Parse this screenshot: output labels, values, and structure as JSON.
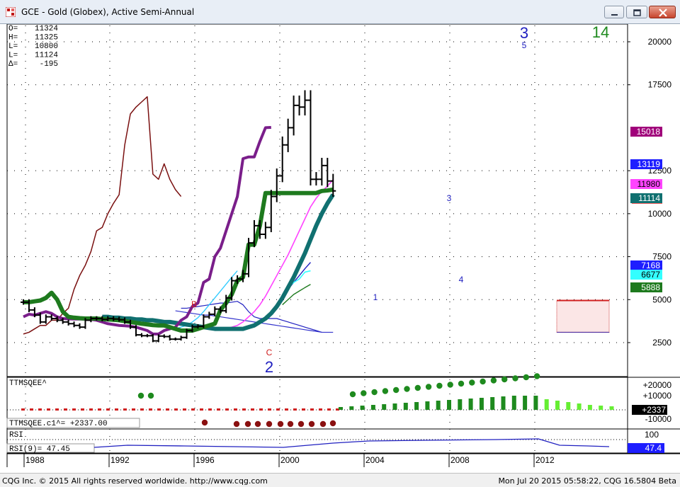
{
  "window": {
    "title": "GCE - Gold (Globex), Active Semi-Annual",
    "buttons": [
      "minimize",
      "restore",
      "close"
    ]
  },
  "ohlc_readout": [
    {
      "label": "O=",
      "value": "11324"
    },
    {
      "label": "H=",
      "value": "11325"
    },
    {
      "label": "L=",
      "value": "10800"
    },
    {
      "label": "L=",
      "value": "11124"
    },
    {
      "label": "Δ=",
      "value": "-195"
    }
  ],
  "wave_labels": {
    "top_count": "3",
    "top_sub": "5",
    "green_count": "14",
    "bottom_count": "2",
    "c_label": "C",
    "b_label": "B",
    "one": "1",
    "three": "3",
    "four": "4"
  },
  "price_axis": {
    "ticks": [
      "20000",
      "17500",
      "12500",
      "10000",
      "7500",
      "5000",
      "2500"
    ],
    "tags": [
      {
        "value": "15018",
        "color": "#a0007a",
        "text_color": "#ffffff"
      },
      {
        "value": "13119",
        "color": "#1e1eff",
        "text_color": "#ffffff"
      },
      {
        "value": "11980",
        "color": "#ff44ff",
        "text_color": "#000000"
      },
      {
        "value": "11114",
        "color": "#107070",
        "text_color": "#ffffff"
      },
      {
        "value": "7168",
        "color": "#1e1eff",
        "text_color": "#ffffff"
      },
      {
        "value": "6677",
        "color": "#33ffff",
        "text_color": "#000000"
      },
      {
        "value": "5888",
        "color": "#1e7a1e",
        "text_color": "#ffffff"
      }
    ]
  },
  "ttm_panel": {
    "label": "TTMSQEE^",
    "readout": "TTMSQEE.c1^=   +2337.00",
    "ticks": [
      "+20000",
      "+10000",
      "-10000"
    ],
    "tag": "+2337"
  },
  "rsi_panel": {
    "label": "RSI",
    "readout": "RSI(9)=    47.45",
    "tick": "100",
    "tag": "47.4"
  },
  "time_axis": {
    "labels": [
      "1988",
      "1992",
      "1996",
      "2000",
      "2004",
      "2008",
      "2012"
    ]
  },
  "status": {
    "left": "CQG Inc. © 2015 All rights reserved worldwide. http://www.cqg.com",
    "right": "Mon Jul 20 2015 05:58:22, CQG 16.5804 Beta"
  },
  "colors": {
    "price_bars": "#000000",
    "ma_green": "#1e7a1e",
    "ma_teal": "#107070",
    "ma_purple": "#7a1e8a",
    "ma_magenta": "#ff44ff",
    "maroon_line": "#7a1010",
    "ttm_up": "#1e8a1e",
    "ttm_down": "#8a1010"
  },
  "chart_data": {
    "type": "ohlc",
    "x": [
      "1987-H2",
      "1988-H1",
      "1988-H2",
      "1989-H1",
      "1989-H2",
      "1990-H1",
      "1990-H2",
      "1991-H1",
      "1991-H2",
      "1992-H1",
      "1992-H2",
      "1993-H1",
      "1993-H2",
      "1994-H1",
      "1994-H2",
      "1995-H1",
      "1995-H2",
      "1996-H1",
      "1996-H2",
      "1997-H1",
      "1997-H2",
      "1998-H1",
      "1998-H2",
      "1999-H1",
      "1999-H2",
      "2000-H1",
      "2000-H2",
      "2001-H1",
      "2001-H2",
      "2002-H1",
      "2002-H2",
      "2003-H1",
      "2003-H2",
      "2004-H1",
      "2004-H2",
      "2005-H1",
      "2005-H2",
      "2006-H1",
      "2006-H2",
      "2007-H1",
      "2007-H2",
      "2008-H1",
      "2008-H2",
      "2009-H1",
      "2009-H2",
      "2010-H1",
      "2010-H2",
      "2011-H1",
      "2011-H2",
      "2012-H1",
      "2012-H2",
      "2013-H1",
      "2013-H2",
      "2014-H1",
      "2014-H2",
      "2015-H1"
    ],
    "close": [
      4850,
      4400,
      4100,
      3700,
      4000,
      3900,
      3800,
      3700,
      3600,
      3500,
      3400,
      3800,
      3900,
      3900,
      3850,
      3900,
      3870,
      3830,
      3700,
      3400,
      2950,
      2900,
      2900,
      2600,
      2880,
      2850,
      2700,
      2700,
      2800,
      3200,
      3420,
      3450,
      4000,
      4150,
      4450,
      4350,
      5100,
      6100,
      6200,
      6500,
      8300,
      9300,
      8800,
      9200,
      11000,
      12200,
      14000,
      15000,
      16300,
      16200,
      16600,
      12000,
      12000,
      12800,
      11900,
      11324
    ],
    "ma_green": [
      4850,
      4850,
      4900,
      4950,
      5100,
      5400,
      5000,
      4300,
      4000,
      3950,
      3920,
      3900,
      3900,
      3900,
      3870,
      3850,
      3830,
      3800,
      3750,
      3700,
      3650,
      3600,
      3560,
      3520,
      3500,
      3500,
      3400,
      3300,
      3200,
      3200,
      3200,
      3300,
      3400,
      3500,
      3600,
      4400,
      4800,
      5300,
      6100,
      6300,
      8200,
      8200,
      9300,
      11200,
      11200,
      11200,
      11200,
      11200,
      11200,
      11200,
      11200,
      11200,
      11200,
      11320,
      11350,
      11400
    ],
    "ma_teal": [
      4000,
      4000,
      3950,
      3950,
      3900,
      3900,
      3850,
      3850,
      3800,
      3800,
      3750,
      3700,
      3700,
      3650,
      3600,
      3550,
      3500,
      3450,
      3400,
      3350,
      3300,
      3300,
      3300,
      3300,
      3300,
      3300,
      3400,
      3500,
      3700,
      3900,
      4200,
      4600,
      5100,
      5700,
      6300,
      7000,
      7700,
      8500,
      9300,
      10000,
      10600,
      11114
    ],
    "ma_purple": [
      4000,
      4150,
      4100,
      4200,
      4300,
      4200,
      4000,
      3900,
      3880,
      3870,
      3870,
      3860,
      3850,
      3800,
      3700,
      3600,
      3550,
      3500,
      3480,
      3450,
      3400,
      3300,
      3200,
      3000,
      3000,
      3200,
      3300,
      3400,
      3800,
      4000,
      4600,
      4800,
      6000,
      6200,
      7500,
      8000,
      9000,
      10000,
      11000,
      13200,
      13300,
      13300,
      14200,
      15000,
      15018
    ],
    "ma_magenta": [
      3200,
      3300,
      3400,
      3500,
      3700,
      4000,
      4300,
      4700,
      5200,
      5800,
      6400,
      7000,
      7600,
      8300,
      9000,
      9700,
      10400,
      10900,
      11300,
      11600,
      11980
    ],
    "maroon_line": [
      3000,
      3100,
      3300,
      3500,
      3500,
      3800,
      3800,
      4200,
      4500,
      5600,
      6400,
      7000,
      7800,
      9000,
      9200,
      10000,
      10600,
      11100,
      14000,
      15800,
      16200,
      16500,
      16800,
      12300,
      12000,
      12900,
      12000,
      11400,
      11000
    ],
    "ma_blue_upper": [
      4500,
      4500,
      4550,
      4600,
      4650,
      4700,
      4750,
      4800,
      4800,
      4850,
      4900,
      4700,
      4300,
      4000,
      3900,
      3900,
      3900,
      3900,
      3800,
      3700,
      3600,
      3500,
      3400,
      3300,
      3200,
      3100
    ],
    "ttm_squeeze_panel": "histogram with up/down dots",
    "rsi_9_last": 47.45,
    "ylim": [
      2000,
      21000
    ],
    "y_ticks": [
      2500,
      5000,
      7500,
      10000,
      12500,
      17500,
      20000
    ],
    "x_tick_labels": [
      "1988",
      "1992",
      "1996",
      "2000",
      "2004",
      "2008",
      "2012"
    ],
    "grid": "dotted"
  }
}
